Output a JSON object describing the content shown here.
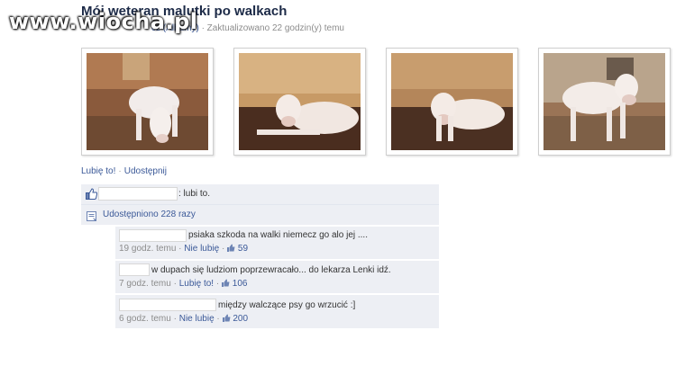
{
  "watermark": "www.wiocha.pl",
  "album": {
    "title": "Mój weteran malutki po walkach",
    "subtitle_author_fragment": "cz",
    "subtitle_album_link": "(Albumy)",
    "subtitle_updated": "· Zaktualizowano 22 godzin(y) temu"
  },
  "photos": [
    {
      "alt": "white bull terrier standing"
    },
    {
      "alt": "white bull terrier lying on blanket"
    },
    {
      "alt": "white bull terrier lying down"
    },
    {
      "alt": "white bull terrier standing in room"
    }
  ],
  "actions": {
    "like": "Lubię to!",
    "separator": "·",
    "share": "Udostępnij"
  },
  "likes": {
    "text": ": lubi to."
  },
  "shares": {
    "text": "Udostępniono 228 razy"
  },
  "comments": [
    {
      "text": "psiaka szkoda na walki niemecz go alo jej ....",
      "time": "19 godz. temu",
      "sep": "·",
      "action": "Nie lubię",
      "sep2": "·",
      "count": "59"
    },
    {
      "text": "w dupach się ludziom poprzewracało... do lekarza Lenki idź.",
      "time": "7 godz. temu",
      "sep": "·",
      "action": "Lubię to!",
      "sep2": "·",
      "count": "106"
    },
    {
      "text": "między walczące psy go wrzucić :]",
      "time": "6 godz. temu",
      "sep": "·",
      "action": "Nie lubię",
      "sep2": "·",
      "count": "200"
    }
  ],
  "colors": {
    "link": "#3b5998",
    "panel": "#edeff4",
    "muted": "#8c8c8c"
  },
  "icons": {
    "like": "thumbs-up-icon",
    "share": "share-icon"
  }
}
